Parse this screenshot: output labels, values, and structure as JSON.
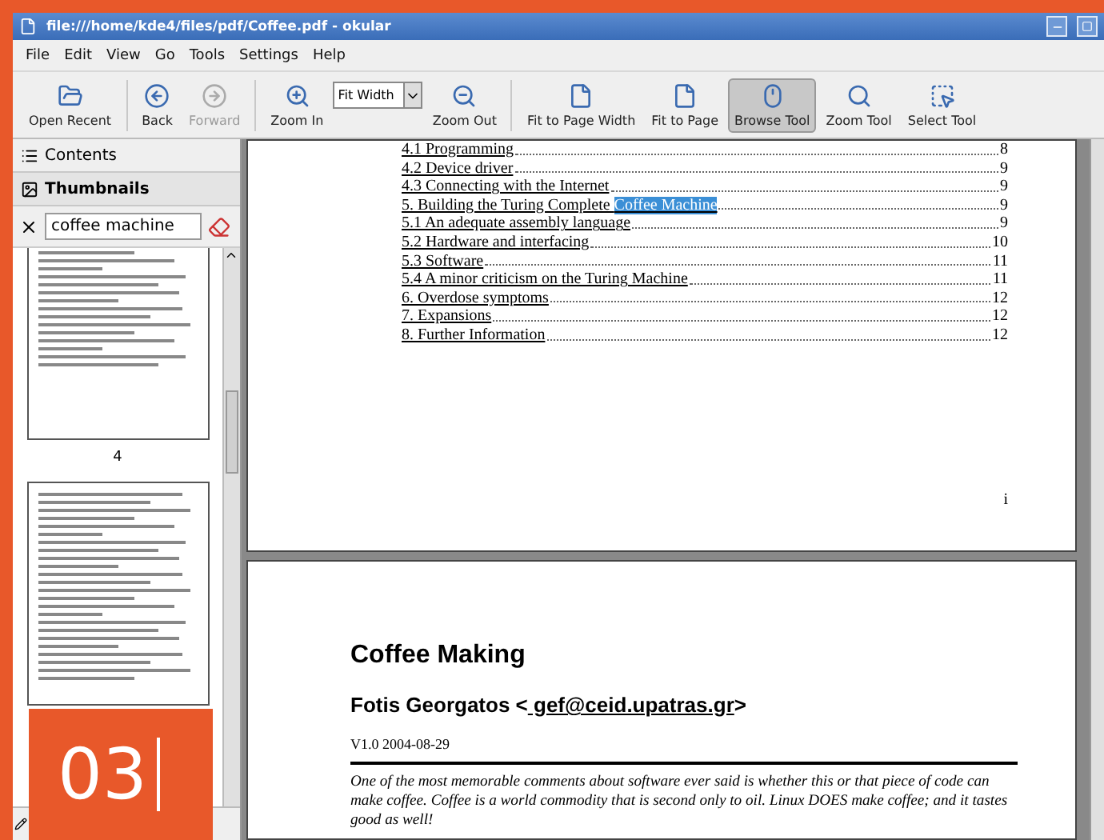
{
  "window": {
    "title": "file:///home/kde4/files/pdf/Coffee.pdf - okular"
  },
  "menu": [
    "File",
    "Edit",
    "View",
    "Go",
    "Tools",
    "Settings",
    "Help"
  ],
  "toolbar": [
    {
      "kind": "button",
      "label": "Open Recent",
      "disabled": false,
      "selected": false
    },
    {
      "kind": "separator"
    },
    {
      "kind": "button",
      "label": "Back",
      "disabled": false,
      "selected": false
    },
    {
      "kind": "button",
      "label": "Forward",
      "disabled": true,
      "selected": false
    },
    {
      "kind": "separator"
    },
    {
      "kind": "button",
      "label": "Zoom In",
      "disabled": false,
      "selected": false
    },
    {
      "kind": "combo",
      "value": "Fit Width"
    },
    {
      "kind": "button",
      "label": "Zoom Out",
      "disabled": false,
      "selected": false
    },
    {
      "kind": "separator"
    },
    {
      "kind": "button",
      "label": "Fit to Page Width",
      "disabled": false,
      "selected": false
    },
    {
      "kind": "button",
      "label": "Fit to Page",
      "disabled": false,
      "selected": false
    },
    {
      "kind": "button",
      "label": "Browse Tool",
      "disabled": false,
      "selected": true
    },
    {
      "kind": "button",
      "label": "Zoom Tool",
      "disabled": false,
      "selected": false
    },
    {
      "kind": "button",
      "label": "Select Tool",
      "disabled": false,
      "selected": false
    }
  ],
  "sidebar": {
    "tabs": [
      {
        "label": "Contents",
        "selected": false
      },
      {
        "label": "Thumbnails",
        "selected": true
      }
    ],
    "search": {
      "value": "coffee machine"
    },
    "thumbnails": [
      {
        "kind": "captioned",
        "caption": "4"
      },
      {
        "kind": "plain"
      }
    ]
  },
  "document": {
    "toc": [
      {
        "text": "4.1 Programming",
        "page": "8"
      },
      {
        "text": "4.2 Device driver",
        "page": "9"
      },
      {
        "text": "4.3 Connecting with the Internet",
        "page": "9"
      },
      {
        "text": "5. Building the Turing Complete ",
        "match": "Coffee Machine",
        "page": "9"
      },
      {
        "text": "5.1 An adequate assembly language",
        "page": "9"
      },
      {
        "text": "5.2 Hardware and interfacing",
        "page": "10"
      },
      {
        "text": "5.3 Software",
        "page": "11"
      },
      {
        "text": "5.4 A minor criticism on the Turing Machine",
        "page": "11"
      },
      {
        "text": "6. Overdose symptoms",
        "page": "12"
      },
      {
        "text": "7. Expansions",
        "page": "12"
      },
      {
        "text": "8. Further Information",
        "page": "12"
      }
    ],
    "page_number": "i",
    "title": "Coffee Making",
    "author": "Fotis Georgatos <",
    "email": " gef@ceid.upatras.gr",
    "author_end": ">",
    "version": "V1.0 2004-08-29",
    "abstract": "One of the most memorable comments about software ever said is whether this or that piece of code can make coffee. Coffee is a world commodity that is second only to oil. Linux DOES make coffee; and it tastes good as well!"
  },
  "badge": "03"
}
